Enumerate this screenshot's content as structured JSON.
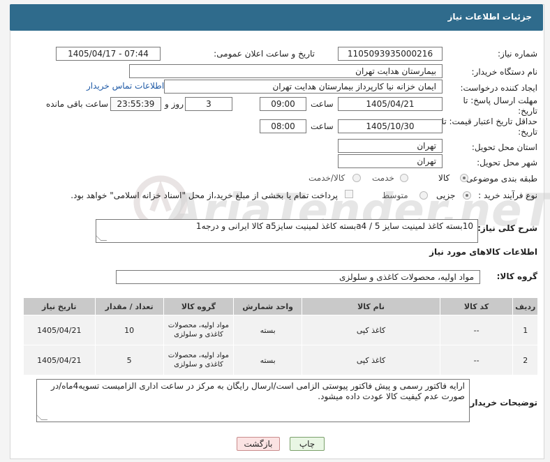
{
  "header": {
    "title": "جزئیات اطلاعات نیاز"
  },
  "watermark": {
    "text": "AriaTender.neT"
  },
  "fields": {
    "need_number_label": "شماره نیاز:",
    "need_number": "1105093935000216",
    "announce_label": "تاریخ و ساعت اعلان عمومی:",
    "announce_value": "1405/04/17 - 07:44",
    "buyer_org_label": "نام دستگاه خریدار:",
    "buyer_org": "بیمارستان هدایت تهران",
    "creator_label": "ایجاد کننده درخواست:",
    "creator": "ایمان خزانه نیا کارپرداز بیمارستان هدایت تهران",
    "contact_link": "اطلاعات تماس خریدار",
    "deadline_label": "مهلت ارسال پاسخ: تا تاریخ:",
    "deadline_date": "1405/04/21",
    "time_label": "ساعت",
    "deadline_time": "09:00",
    "days_value": "3",
    "days_label": "روز و",
    "remaining_time": "23:55:39",
    "remaining_label": "ساعت باقی مانده",
    "validity_label": "حداقل تاریخ اعتبار قیمت: تا تاریخ:",
    "validity_date": "1405/10/30",
    "validity_time": "08:00",
    "province_label": "استان محل تحویل:",
    "province": "تهران",
    "city_label": "شهر محل تحویل:",
    "city": "تهران",
    "category_label": "طبقه بندی موضوعی:",
    "category_options": [
      "کالا",
      "خدمت",
      "کالا/خدمت"
    ],
    "process_label": "نوع فرآیند خرید :",
    "process_options": [
      "جزیی",
      "متوسط"
    ],
    "payment_note": "پرداخت تمام یا بخشی از مبلغ خرید،از محل \"اسناد خزانه اسلامی\" خواهد بود."
  },
  "summary": {
    "label": "شرح کلی نیاز:",
    "text": "10بسته کاغذ لمینیت سایز a4 / 5بسته کاغذ لمینیت سایزa5 کالا ایرانی و درجه1"
  },
  "goods_info_title": "اطلاعات کالاهای مورد نیاز",
  "goods_group": {
    "label": "گروه کالا:",
    "value": "مواد اولیه، محصولات کاغذی و سلولزی"
  },
  "table": {
    "headers": [
      "ردیف",
      "کد کالا",
      "نام کالا",
      "واحد شمارش",
      "گروه کالا",
      "تعداد / مقدار",
      "تاریخ نیاز"
    ],
    "rows": [
      {
        "row": "1",
        "code": "--",
        "name": "کاغذ کپی",
        "unit": "بسته",
        "group": "مواد اولیه، محصولات کاغذی و سلولزی",
        "qty": "10",
        "date": "1405/04/21"
      },
      {
        "row": "2",
        "code": "--",
        "name": "کاغذ کپی",
        "unit": "بسته",
        "group": "مواد اولیه، محصولات کاغذی و سلولزی",
        "qty": "5",
        "date": "1405/04/21"
      }
    ]
  },
  "buyer_notes": {
    "label": "توضیحات خریدار:",
    "text": "ارایه فاکتور رسمی و پیش فاکتور پیوستی الزامی است/ارسال رایگان به مرکز در ساعت اداری الزامیست تسویه4ماه/در صورت عدم کیفیت کالا عودت داده میشود."
  },
  "buttons": {
    "print": "چاپ",
    "back": "بازگشت"
  }
}
